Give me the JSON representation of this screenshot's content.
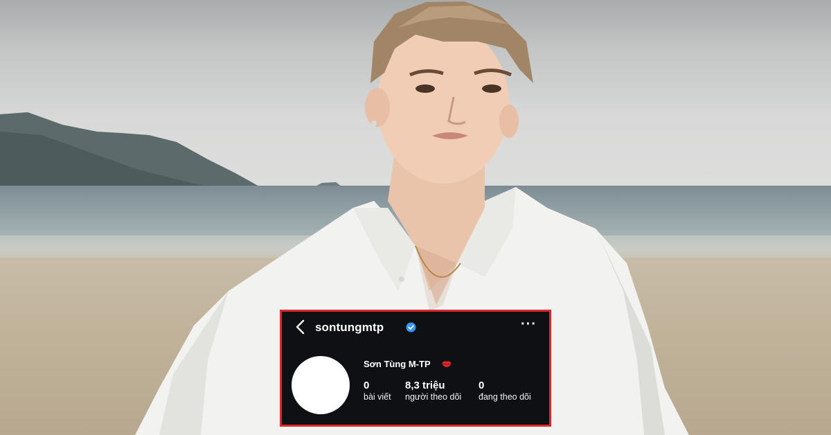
{
  "profile": {
    "username": "sontungmtp",
    "display_name": "Sơn Tùng M-TP",
    "verified": true,
    "stats": [
      {
        "value": "0",
        "label": "bài viết"
      },
      {
        "value": "8,3 triệu",
        "label": "người theo dõi"
      },
      {
        "value": "0",
        "label": "đang theo dõi"
      }
    ]
  },
  "icons": {
    "back": "chevron-left-icon",
    "verified": "verified-badge-icon",
    "more": "more-options-icon",
    "emoji": "lips-kiss-icon"
  },
  "colors": {
    "highlight_border": "#e0262e",
    "panel_background": "#0f1014",
    "verified_blue": "#3897f0"
  }
}
